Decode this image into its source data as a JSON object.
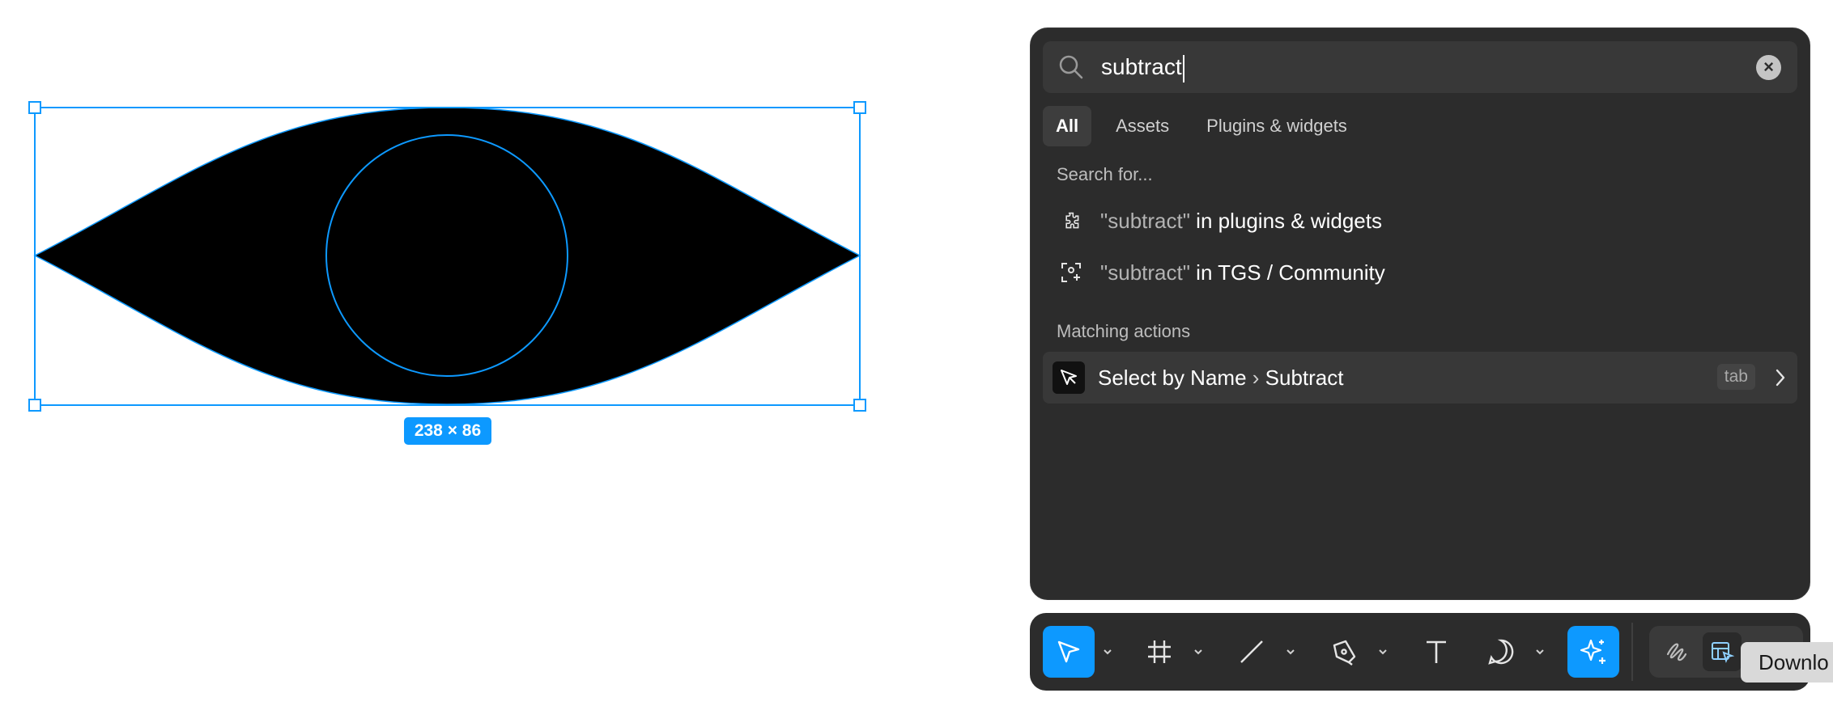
{
  "canvas": {
    "dimension_badge": "238 × 86",
    "selection_color": "#0d99ff"
  },
  "palette": {
    "search": {
      "value": "subtract",
      "clear_icon": "close-icon"
    },
    "tabs": [
      {
        "label": "All",
        "active": true
      },
      {
        "label": "Assets",
        "active": false
      },
      {
        "label": "Plugins & widgets",
        "active": false
      }
    ],
    "search_for_label": "Search for...",
    "search_for_items": [
      {
        "icon": "plugin-icon",
        "query": "\"subtract\"",
        "suffix": " in plugins & widgets"
      },
      {
        "icon": "community-icon",
        "query": "\"subtract\"",
        "suffix": " in TGS / Community"
      }
    ],
    "matching_actions_label": "Matching actions",
    "actions": [
      {
        "icon": "select-by-name-icon",
        "label": "Select by Name",
        "sub": " Subtract",
        "key_hint": "tab"
      }
    ]
  },
  "toolbar": {
    "tools": [
      {
        "name": "move-tool",
        "icon": "cursor-icon",
        "active": true
      },
      {
        "name": "frame-tool",
        "icon": "frame-icon"
      },
      {
        "name": "line-tool",
        "icon": "line-icon"
      },
      {
        "name": "pen-tool",
        "icon": "pen-icon"
      },
      {
        "name": "text-tool",
        "icon": "text-icon"
      },
      {
        "name": "comment-tool",
        "icon": "comment-icon"
      },
      {
        "name": "ai-tool",
        "icon": "sparkle-icon",
        "active": true
      }
    ],
    "modes": [
      {
        "icon": "draw-icon"
      },
      {
        "icon": "dev-mode-icon",
        "selected": true
      }
    ]
  },
  "tooltip": {
    "text": "Downlo"
  },
  "colors": {
    "accent": "#0d99ff",
    "panel": "#2c2c2c"
  }
}
